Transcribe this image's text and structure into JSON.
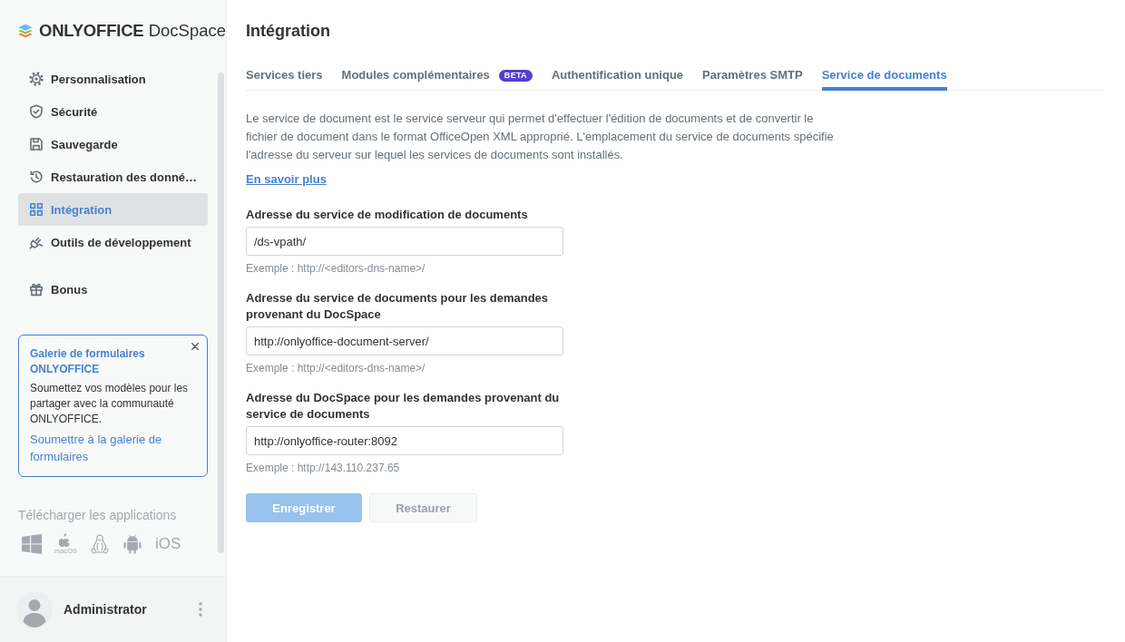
{
  "sidebar": {
    "logo": {
      "text": "**ONLYOFFICE** DocSpace"
    },
    "items": [
      {
        "label": "Personnalisation",
        "selected": false
      },
      {
        "label": "Sécurité",
        "selected": false
      },
      {
        "label": "Sauvegarde",
        "selected": false
      },
      {
        "label": "Restauration des donné…",
        "selected": false
      },
      {
        "label": "Intégration",
        "selected": true
      },
      {
        "label": "Outils de développement",
        "selected": false
      }
    ],
    "extra_items": [
      {
        "label": "Bonus",
        "selected": false
      }
    ],
    "promo": {
      "title": "Galerie de formulaires ONLYOFFICE",
      "text": "Soumettez vos modèles pour les partager avec la communauté ONLYOFFICE.",
      "link": "Soumettre à la galerie de formulaires"
    },
    "downloads": {
      "title": "Télécharger les applications",
      "apps": [
        {
          "kind": "windows"
        },
        {
          "kind": "macos",
          "label": "macOS"
        },
        {
          "kind": "linux"
        },
        {
          "kind": "android"
        },
        {
          "kind": "ios",
          "label": "iOS"
        }
      ]
    },
    "profile": {
      "name": "Administrator"
    }
  },
  "main": {
    "title": "Intégration",
    "tabs": [
      {
        "label": "Services tiers",
        "selected": false
      },
      {
        "label": "Modules complémentaires",
        "badge": "BETA",
        "selected": false
      },
      {
        "label": "Authentification unique",
        "selected": false
      },
      {
        "label": "Paramètres SMTP",
        "selected": false
      },
      {
        "label": "Service de documents",
        "selected": true
      }
    ],
    "description": "Le service de document est le service serveur qui permet d'effectuer l'édition de documents et de convertir le fichier de document dans le format OfficeOpen XML approprié. L'emplacement du service de documents spécifie l'adresse du serveur sur lequel les services de documents sont installés.",
    "learn_more": "En savoir plus",
    "fields": [
      {
        "label": "Adresse du service de modification de documents",
        "value": "/ds-vpath/",
        "hint": "Exemple : http://<editors-dns-name>/"
      },
      {
        "label": "Adresse du service de documents pour les demandes provenant du DocSpace",
        "value": "http://onlyoffice-document-server/",
        "hint": "Exemple : http://<editors-dns-name>/"
      },
      {
        "label": "Adresse du DocSpace pour les demandes provenant du service de documents",
        "value": "http://onlyoffice-router:8092",
        "hint": "Exemple : http://143.110.237.65"
      }
    ],
    "buttons": [
      {
        "label": "Enregistrer",
        "kind": "primary",
        "disabled": true
      },
      {
        "label": "Restaurer",
        "kind": "secondary",
        "disabled": true
      }
    ]
  }
}
